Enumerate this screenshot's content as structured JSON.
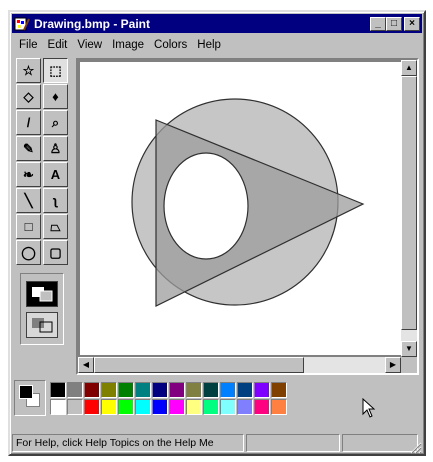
{
  "window": {
    "title": "Drawing.bmp - Paint",
    "controls": {
      "minimize": "_",
      "maximize": "□",
      "close": "×"
    }
  },
  "menu": [
    "File",
    "Edit",
    "View",
    "Image",
    "Colors",
    "Help"
  ],
  "toolbox": {
    "tools": [
      {
        "name": "free-form-select-icon",
        "glyph": "☆"
      },
      {
        "name": "select-icon",
        "glyph": "⬚"
      },
      {
        "name": "eraser-icon",
        "glyph": "◇"
      },
      {
        "name": "fill-icon",
        "glyph": "♦"
      },
      {
        "name": "pick-color-icon",
        "glyph": "/"
      },
      {
        "name": "magnifier-icon",
        "glyph": "⌕"
      },
      {
        "name": "pencil-icon",
        "glyph": "✎"
      },
      {
        "name": "brush-icon",
        "glyph": "♙"
      },
      {
        "name": "airbrush-icon",
        "glyph": "❧"
      },
      {
        "name": "text-icon",
        "glyph": "A"
      },
      {
        "name": "line-icon",
        "glyph": "╲"
      },
      {
        "name": "curve-icon",
        "glyph": "ʅ"
      },
      {
        "name": "rectangle-icon",
        "glyph": "□"
      },
      {
        "name": "polygon-icon",
        "glyph": "⏢"
      },
      {
        "name": "ellipse-icon",
        "glyph": "◯"
      },
      {
        "name": "rounded-rectangle-icon",
        "glyph": "▢"
      }
    ],
    "options": [
      "opaque-option-icon",
      "transparent-option-icon"
    ]
  },
  "canvas": {
    "shapes": {
      "circle_fill": "#c6c6c6",
      "triangle_fill": "#9c9c9c",
      "overlap_fill": "#aaaaaa",
      "inner_ellipse_fill": "#ffffff",
      "stroke": "#303030"
    }
  },
  "colors": {
    "foreground": "#000000",
    "background": "#ffffff",
    "swatches": [
      "#000000",
      "#808080",
      "#800000",
      "#808000",
      "#008000",
      "#008080",
      "#000080",
      "#800080",
      "#808040",
      "#004040",
      "#0080ff",
      "#004080",
      "#8000ff",
      "#804000",
      "#ffffff",
      "#c0c0c0",
      "#ff0000",
      "#ffff00",
      "#00ff00",
      "#00ffff",
      "#0000ff",
      "#ff00ff",
      "#ffff80",
      "#00ff80",
      "#80ffff",
      "#8080ff",
      "#ff0080",
      "#ff8040"
    ]
  },
  "status": {
    "help": "For Help, click Help Topics on the Help Me",
    "coords": "",
    "size": ""
  }
}
